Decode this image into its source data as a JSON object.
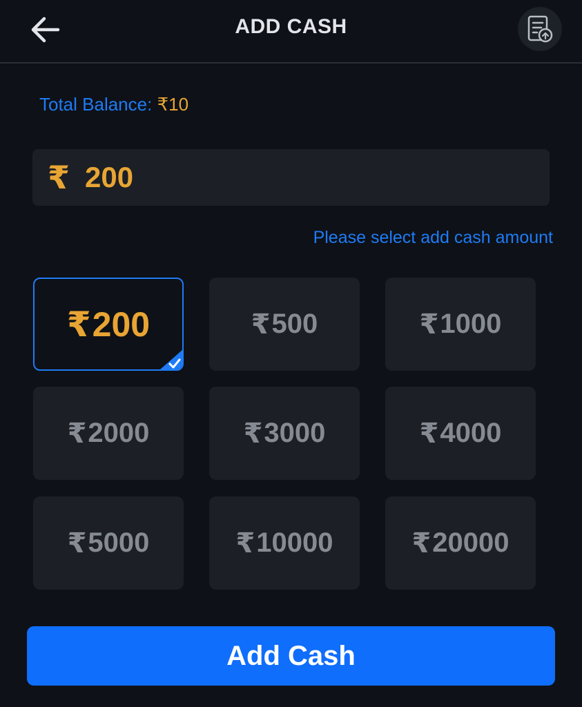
{
  "header": {
    "title": "ADD CASH",
    "back_icon": "back-arrow-icon",
    "history_icon": "transaction-history-icon"
  },
  "balance": {
    "label": "Total Balance: ",
    "value": "₹10"
  },
  "amount_input": {
    "currency_symbol": "₹",
    "value": "200"
  },
  "hint": "Please select add cash amount",
  "amount_options": [
    {
      "symbol": "₹",
      "amount": "200",
      "selected": true
    },
    {
      "symbol": "₹",
      "amount": "500",
      "selected": false
    },
    {
      "symbol": "₹",
      "amount": "1000",
      "selected": false
    },
    {
      "symbol": "₹",
      "amount": "2000",
      "selected": false
    },
    {
      "symbol": "₹",
      "amount": "3000",
      "selected": false
    },
    {
      "symbol": "₹",
      "amount": "4000",
      "selected": false
    },
    {
      "symbol": "₹",
      "amount": "5000",
      "selected": false
    },
    {
      "symbol": "₹",
      "amount": "10000",
      "selected": false
    },
    {
      "symbol": "₹",
      "amount": "20000",
      "selected": false
    }
  ],
  "submit_button": {
    "label": "Add Cash"
  },
  "colors": {
    "background": "#0e1117",
    "accent_blue": "#1e7bf5",
    "gold": "#e8a534",
    "tile_bg": "#1c1f25",
    "tile_text": "#868b93",
    "button_blue": "#0f6efb"
  }
}
